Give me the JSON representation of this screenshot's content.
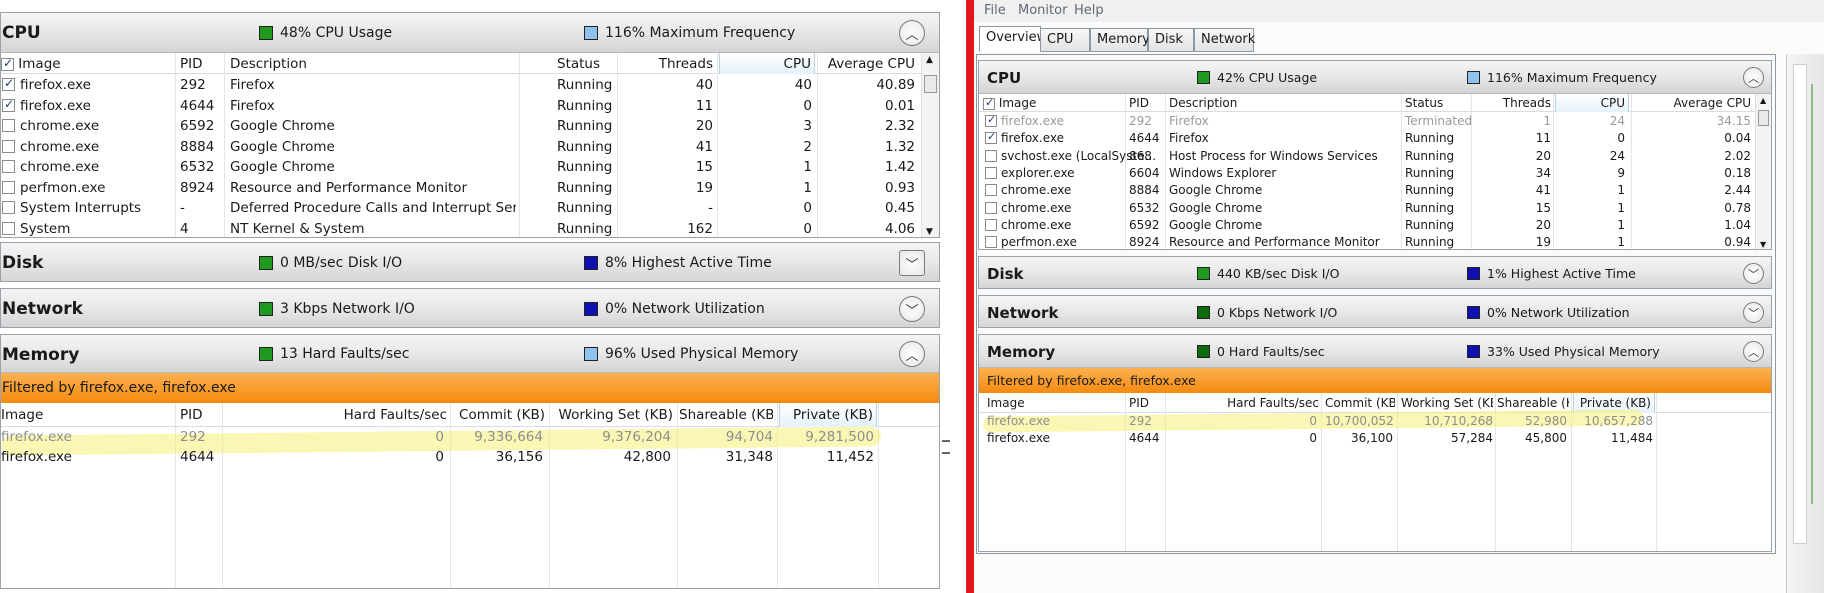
{
  "left": {
    "cpu": {
      "title": "CPU",
      "usage": "48% CPU Usage",
      "freq": "116% Maximum Frequency",
      "columns": [
        "Image",
        "PID",
        "Description",
        "Status",
        "Threads",
        "CPU",
        "Average CPU"
      ],
      "rows": [
        {
          "checked": true,
          "image": "firefox.exe",
          "pid": "292",
          "desc": "Firefox",
          "status": "Running",
          "threads": "40",
          "cpu": "40",
          "avg": "40.89"
        },
        {
          "checked": true,
          "image": "firefox.exe",
          "pid": "4644",
          "desc": "Firefox",
          "status": "Running",
          "threads": "11",
          "cpu": "0",
          "avg": "0.01"
        },
        {
          "checked": false,
          "image": "chrome.exe",
          "pid": "6592",
          "desc": "Google Chrome",
          "status": "Running",
          "threads": "20",
          "cpu": "3",
          "avg": "2.32"
        },
        {
          "checked": false,
          "image": "chrome.exe",
          "pid": "8884",
          "desc": "Google Chrome",
          "status": "Running",
          "threads": "41",
          "cpu": "2",
          "avg": "1.32"
        },
        {
          "checked": false,
          "image": "chrome.exe",
          "pid": "6532",
          "desc": "Google Chrome",
          "status": "Running",
          "threads": "15",
          "cpu": "1",
          "avg": "1.42"
        },
        {
          "checked": false,
          "image": "perfmon.exe",
          "pid": "8924",
          "desc": "Resource and Performance Monitor",
          "status": "Running",
          "threads": "19",
          "cpu": "1",
          "avg": "0.93"
        },
        {
          "checked": false,
          "image": "System Interrupts",
          "pid": "-",
          "desc": "Deferred Procedure Calls and Interrupt Servic...",
          "status": "Running",
          "threads": "-",
          "cpu": "0",
          "avg": "0.45"
        },
        {
          "checked": false,
          "image": "System",
          "pid": "4",
          "desc": "NT Kernel & System",
          "status": "Running",
          "threads": "162",
          "cpu": "0",
          "avg": "4.06"
        }
      ]
    },
    "disk": {
      "title": "Disk",
      "io": "0 MB/sec Disk I/O",
      "active": "8% Highest Active Time"
    },
    "network": {
      "title": "Network",
      "io": "3 Kbps Network I/O",
      "util": "0% Network Utilization"
    },
    "memory": {
      "title": "Memory",
      "faults": "13 Hard Faults/sec",
      "used": "96% Used Physical Memory",
      "filter": "Filtered by firefox.exe, firefox.exe",
      "columns": [
        "Image",
        "PID",
        "Hard Faults/sec",
        "Commit (KB)",
        "Working Set (KB)",
        "Shareable (KB)",
        "Private (KB)"
      ],
      "rows": [
        {
          "image": "firefox.exe",
          "pid": "292",
          "faults": "0",
          "commit": "9,336,664",
          "ws": "9,376,204",
          "share": "94,704",
          "priv": "9,281,500"
        },
        {
          "image": "firefox.exe",
          "pid": "4644",
          "faults": "0",
          "commit": "36,156",
          "ws": "42,800",
          "share": "31,348",
          "priv": "11,452"
        }
      ]
    }
  },
  "right": {
    "menu": [
      "File",
      "Monitor",
      "Help"
    ],
    "tabs": [
      "Overview",
      "CPU",
      "Memory",
      "Disk",
      "Network"
    ],
    "cpu": {
      "title": "CPU",
      "usage": "42% CPU Usage",
      "freq": "116% Maximum Frequency",
      "columns": [
        "Image",
        "PID",
        "Description",
        "Status",
        "Threads",
        "CPU",
        "Average CPU"
      ],
      "rows": [
        {
          "checked": true,
          "image": "firefox.exe",
          "pid": "292",
          "desc": "Firefox",
          "status": "Terminated",
          "threads": "1",
          "cpu": "24",
          "avg": "34.15"
        },
        {
          "checked": true,
          "image": "firefox.exe",
          "pid": "4644",
          "desc": "Firefox",
          "status": "Running",
          "threads": "11",
          "cpu": "0",
          "avg": "0.04"
        },
        {
          "checked": false,
          "image": "svchost.exe (LocalSyste...",
          "pid": "868",
          "desc": "Host Process for Windows Services",
          "status": "Running",
          "threads": "20",
          "cpu": "24",
          "avg": "2.02"
        },
        {
          "checked": false,
          "image": "explorer.exe",
          "pid": "6604",
          "desc": "Windows Explorer",
          "status": "Running",
          "threads": "34",
          "cpu": "9",
          "avg": "0.18"
        },
        {
          "checked": false,
          "image": "chrome.exe",
          "pid": "8884",
          "desc": "Google Chrome",
          "status": "Running",
          "threads": "41",
          "cpu": "1",
          "avg": "2.44"
        },
        {
          "checked": false,
          "image": "chrome.exe",
          "pid": "6532",
          "desc": "Google Chrome",
          "status": "Running",
          "threads": "15",
          "cpu": "1",
          "avg": "0.78"
        },
        {
          "checked": false,
          "image": "chrome.exe",
          "pid": "6592",
          "desc": "Google Chrome",
          "status": "Running",
          "threads": "20",
          "cpu": "1",
          "avg": "1.04"
        },
        {
          "checked": false,
          "image": "perfmon.exe",
          "pid": "8924",
          "desc": "Resource and Performance Monitor",
          "status": "Running",
          "threads": "19",
          "cpu": "1",
          "avg": "0.94"
        }
      ]
    },
    "disk": {
      "title": "Disk",
      "io": "440 KB/sec Disk I/O",
      "active": "1% Highest Active Time"
    },
    "network": {
      "title": "Network",
      "io": "0 Kbps Network I/O",
      "util": "0% Network Utilization"
    },
    "memory": {
      "title": "Memory",
      "faults": "0 Hard Faults/sec",
      "used": "33% Used Physical Memory",
      "filter": "Filtered by firefox.exe, firefox.exe",
      "columns": [
        "Image",
        "PID",
        "Hard Faults/sec",
        "Commit (KB)",
        "Working Set (KB)",
        "Shareable (KB)",
        "Private (KB)"
      ],
      "rows": [
        {
          "image": "firefox.exe",
          "pid": "292",
          "faults": "0",
          "commit": "10,700,052",
          "ws": "10,710,268",
          "share": "52,980",
          "priv": "10,657,288"
        },
        {
          "image": "firefox.exe",
          "pid": "4644",
          "faults": "0",
          "commit": "36,100",
          "ws": "57,284",
          "share": "45,800",
          "priv": "11,484"
        }
      ]
    }
  },
  "colors": {
    "green": "#1f9a1f",
    "lightblue": "#8fc3ee",
    "darkblue": "#1010b0",
    "filter": "#f7981f",
    "divider": "#e3161a"
  },
  "icons": {
    "expand": "chevron-down-icon",
    "collapse": "chevron-up-icon"
  }
}
